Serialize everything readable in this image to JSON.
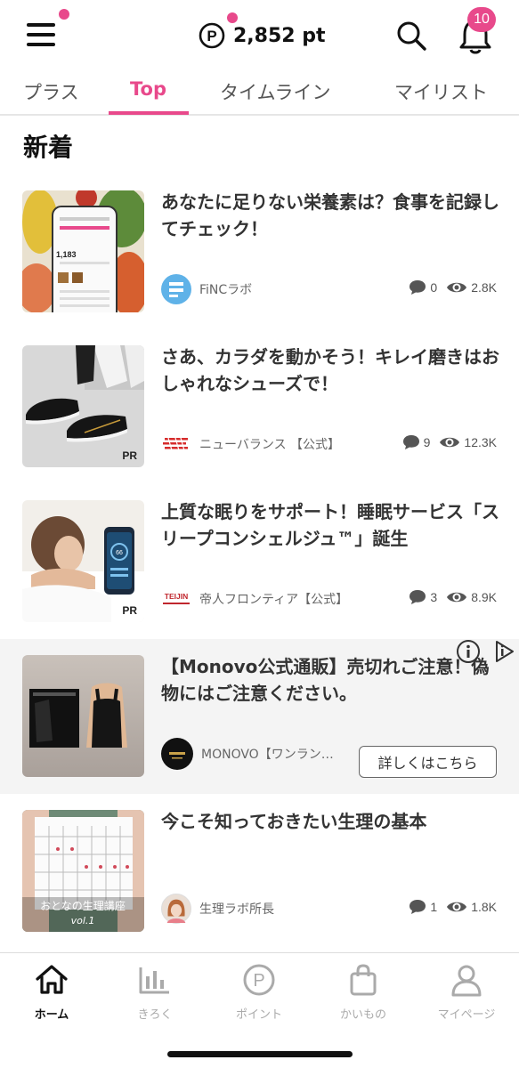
{
  "header": {
    "points_text": "2,852 pt",
    "notification_count": "10"
  },
  "tabs": [
    {
      "label": "プラス"
    },
    {
      "label": "Top"
    },
    {
      "label": "タイムライン"
    },
    {
      "label": "マイリスト"
    }
  ],
  "section_title": "新着",
  "articles": [
    {
      "title": "あなたに足りない栄養素は？食事を記録してチェック！",
      "source": "FiNCラボ",
      "comments": "0",
      "views": "2.8K",
      "pr": "",
      "thumb_text": "1,183"
    },
    {
      "title": "さあ、カラダを動かそう！キレイ磨きはおしゃれなシューズで！",
      "source": "ニューバランス 【公式】",
      "comments": "9",
      "views": "12.3K",
      "pr": "PR"
    },
    {
      "title": "上質な眠りをサポート！睡眠サービス「スリープコンシェルジュ™」誕生",
      "source": "帝人フロンティア【公式】",
      "comments": "3",
      "views": "8.9K",
      "pr": "PR",
      "source_logo_text": "TEIJIN"
    },
    {
      "title": "【Monovo公式通販】売切れご注意！偽物にはご注意ください。",
      "source": "MONOVO【ワンラン…",
      "button_label": "詳しくはこちら"
    },
    {
      "title": "今こそ知っておきたい生理の基本",
      "source": "生理ラボ所長",
      "comments": "1",
      "views": "1.8K",
      "thumb_caption": "おとなの生理講座",
      "thumb_caption2": "vol.1"
    }
  ],
  "bottom_nav": [
    {
      "label": "ホーム",
      "icon": "home-icon"
    },
    {
      "label": "きろく",
      "icon": "chart-icon"
    },
    {
      "label": "ポイント",
      "icon": "points-icon"
    },
    {
      "label": "かいもの",
      "icon": "shopping-bag-icon"
    },
    {
      "label": "マイページ",
      "icon": "person-icon"
    }
  ],
  "colors": {
    "accent": "#e8498b",
    "text": "#333333"
  }
}
